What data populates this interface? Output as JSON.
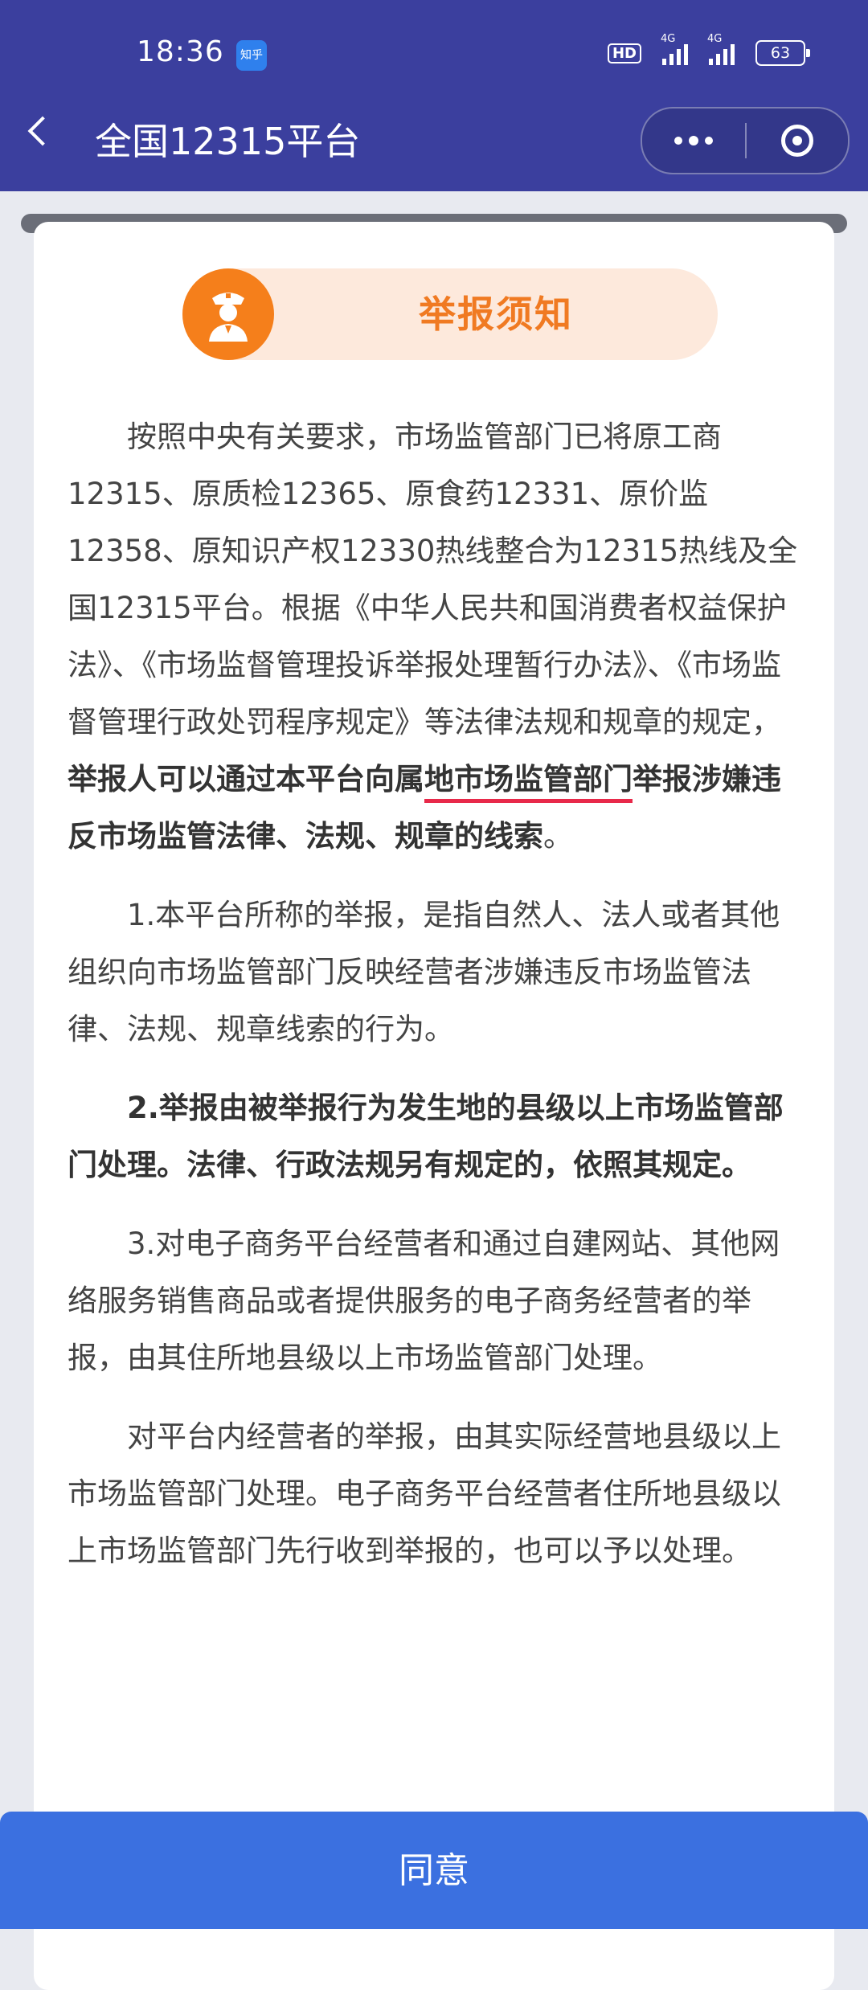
{
  "status_bar": {
    "time": "18:36",
    "app_badge": "知乎",
    "hd": "HD",
    "signal_1": "4G",
    "signal_2": "4G",
    "battery": "63"
  },
  "nav": {
    "title": "全国12315平台"
  },
  "notice": {
    "title": "举报须知",
    "p1_a": "按照中央有关要求，市场监管部门已将原工商12315、原质检12365、原食药12331、原价监12358、原知识产权12330热线整合为12315热线及全国12315平台。根据《中华人民共和国消费者权益保护法》、《市场监督管理投诉举报处理暂行办法》、《市场监督管理行政处罚程序规定》等法律法规和规章的规定，",
    "p1_b1": "举报人可以通过本平台向属",
    "p1_b2": "地市场监管部门",
    "p1_b3": "举报涉嫌违反市场监管法律、法规、规章的线索",
    "p1_end": "。",
    "p2": "1.本平台所称的举报，是指自然人、法人或者其他组织向市场监管部门反映经营者涉嫌违反市场监管法律、法规、规章线索的行为。",
    "p3": "2.举报由被举报行为发生地的县级以上市场监管部门处理。法律、行政法规另有规定的，依照其规定。",
    "p4": "3.对电子商务平台经营者和通过自建网站、其他网络服务销售商品或者提供服务的电子商务经营者的举报，由其住所地县级以上市场监管部门处理。",
    "p5": "对平台内经营者的举报，由其实际经营地县级以上市场监管部门处理。电子商务平台经营者住所地县级以上市场监管部门先行收到举报的，也可以予以处理。"
  },
  "footer": {
    "agree_label": "同意"
  },
  "colors": {
    "header_bg": "#3b3f9e",
    "accent_orange": "#f57f1b",
    "agree_bg": "#3b70e0",
    "underline_red": "#e8294a"
  }
}
